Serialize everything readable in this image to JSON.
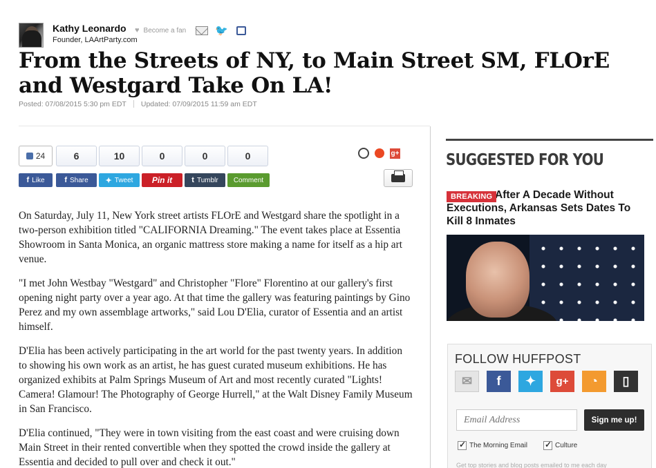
{
  "author": {
    "name": "Kathy Leonardo",
    "role": "Founder, LAArtParty.com",
    "become_fan": "Become a fan"
  },
  "article": {
    "title": "From the Streets of NY, to Main Street SM, FLOrE and Westgard Take On LA!",
    "posted": "Posted: 07/08/2015 5:30 pm EDT",
    "updated": "Updated: 07/09/2015 11:59 am EDT",
    "paragraphs": [
      "On Saturday, July 11, New York street artists FLOrE and Westgard share the spotlight in a two-person exhibition titled \"CALIFORNIA Dreaming.\" The event takes place at Essentia Showroom in Santa Monica, an organic mattress store making a name for itself as a hip art venue.",
      "\"I met John Westbay \"Westgard\" and Christopher \"Flore\" Florentino at our gallery's first opening night party over a year ago. At that time the gallery was featuring paintings by Gino Perez and my own assemblage artworks,\" said Lou D'Elia, curator of Essentia and an artist himself.",
      "D'Elia has been actively participating in the art world for the past twenty years. In addition to showing his own work as an artist, he has guest curated museum exhibitions. He has organized exhibits at Palm Springs Museum of Art and most recently curated \"Lights! Camera! Glamour! The Photography of George Hurrell,\" at the Walt Disney Family Museum in San Francisco.",
      "D'Elia continued, \"They were in town visiting from the east coast and were cruising down Main Street in their rented convertible when they spotted the crowd inside the gallery at Essentia and decided to pull over and check it out.\""
    ]
  },
  "share": {
    "like_count": "24",
    "counts": [
      "6",
      "10",
      "0",
      "0",
      "0"
    ],
    "buttons": {
      "like": "Like",
      "share": "Share",
      "tweet": "Tweet",
      "pin": "Pin it",
      "tumblr": "Tumblr",
      "comment": "Comment"
    },
    "google_plus": "g+"
  },
  "sidebar": {
    "suggested_title": "SUGGESTED FOR YOU",
    "breaking_label": "BREAKING",
    "headline": "After A Decade Without Executions, Arkansas Sets Dates To Kill 8 Inmates",
    "follow_title": "FOLLOW HUFFPOST",
    "email_placeholder": "Email Address",
    "signup_label": "Sign me up!",
    "checkbox_morning": "The Morning Email",
    "checkbox_culture": "Culture",
    "fine_print": "Get top stories and blog posts emailed to me each day"
  },
  "colors": {
    "facebook": "#3b5998",
    "twitter": "#2ea7e0",
    "pinterest": "#cb2027",
    "tumblr": "#35465c",
    "comment": "#5a9b2f",
    "breaking": "#d6323a",
    "google_plus": "#dd4b39",
    "rss": "#f39a2f"
  }
}
